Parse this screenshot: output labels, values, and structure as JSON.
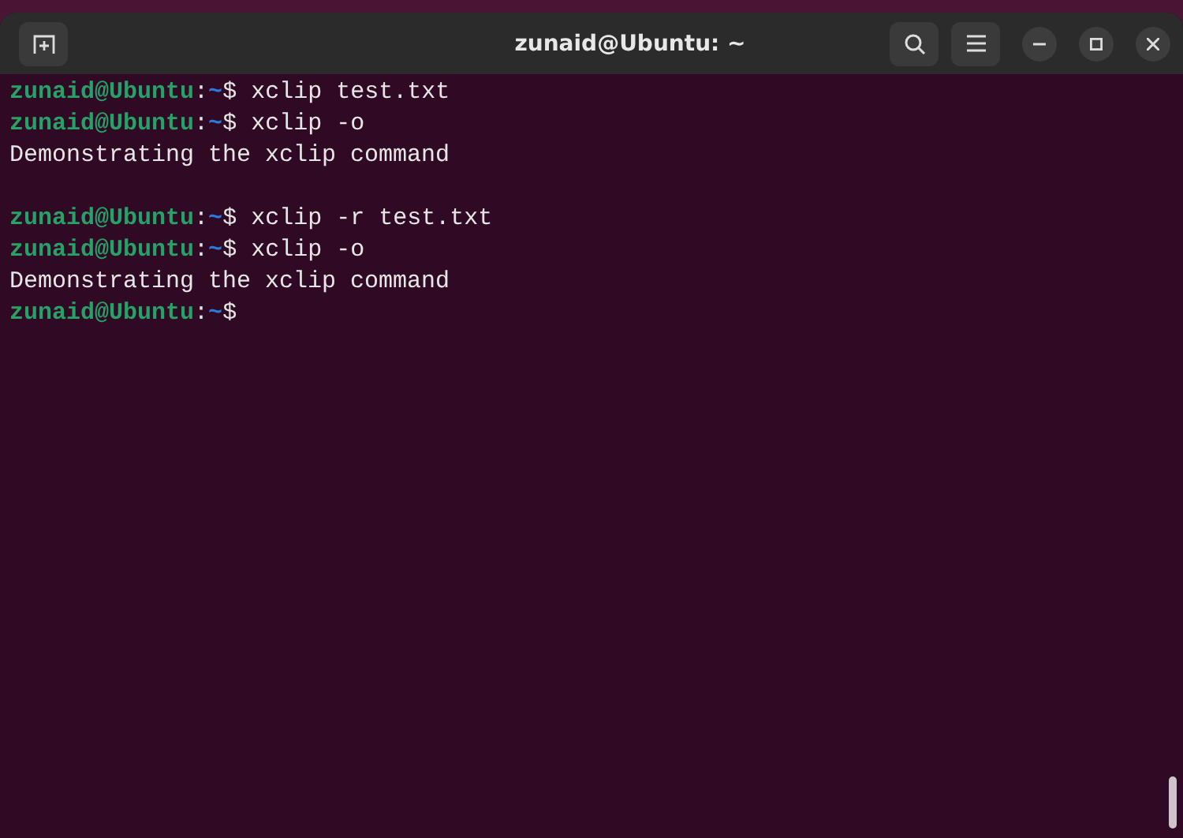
{
  "window": {
    "title": "zunaid@Ubuntu: ~"
  },
  "lines": [
    {
      "kind": "prompt",
      "user": "zunaid@Ubuntu",
      "separator": ":",
      "path": "~",
      "symbol": "$",
      "command": " xclip test.txt"
    },
    {
      "kind": "prompt",
      "user": "zunaid@Ubuntu",
      "separator": ":",
      "path": "~",
      "symbol": "$",
      "command": " xclip -o"
    },
    {
      "kind": "output",
      "text": "Demonstrating the xclip command"
    },
    {
      "kind": "blank"
    },
    {
      "kind": "prompt",
      "user": "zunaid@Ubuntu",
      "separator": ":",
      "path": "~",
      "symbol": "$",
      "command": " xclip -r test.txt"
    },
    {
      "kind": "prompt",
      "user": "zunaid@Ubuntu",
      "separator": ":",
      "path": "~",
      "symbol": "$",
      "command": " xclip -o"
    },
    {
      "kind": "output",
      "text": "Demonstrating the xclip command"
    },
    {
      "kind": "prompt",
      "user": "zunaid@Ubuntu",
      "separator": ":",
      "path": "~",
      "symbol": "$"
    }
  ]
}
